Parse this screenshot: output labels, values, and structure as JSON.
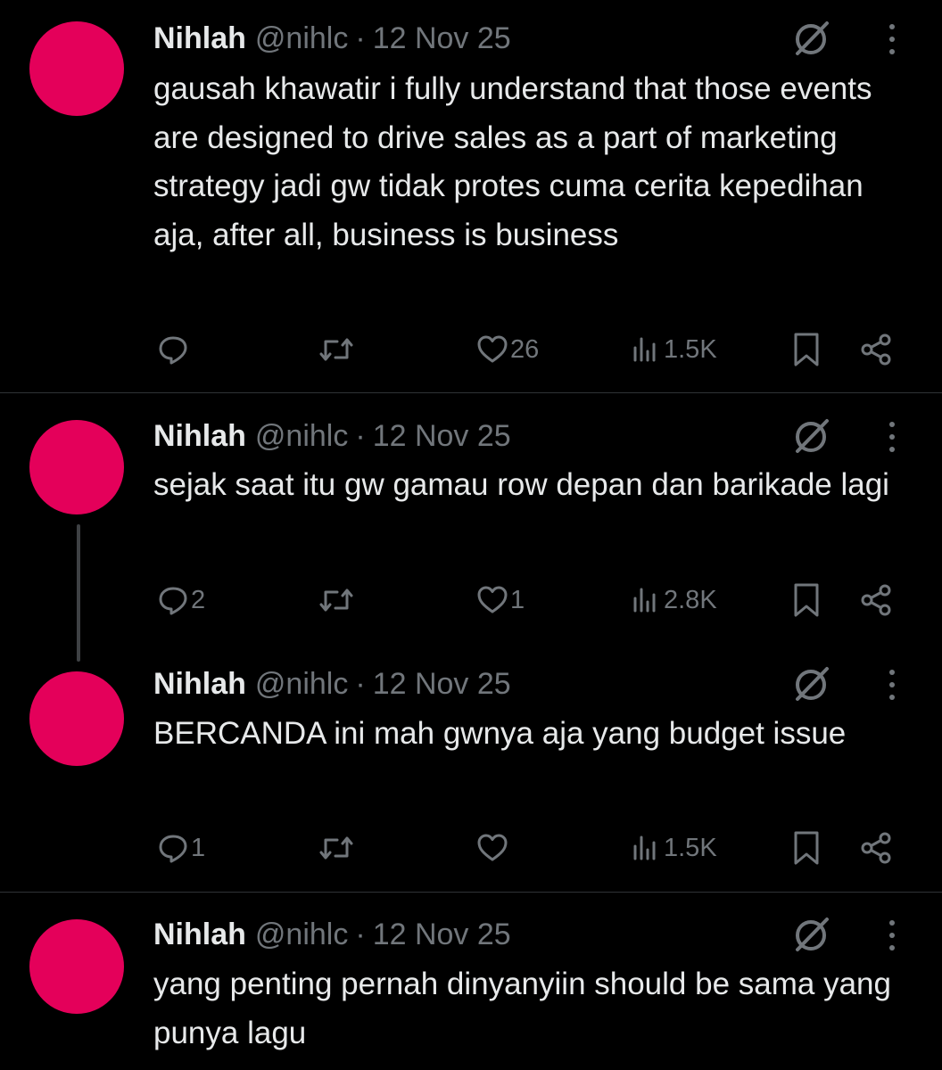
{
  "tweets": [
    {
      "author_name": "Nihlah",
      "handle": "@nihlc",
      "separator": "·",
      "date": "12 Nov 25",
      "text": "gausah khawatir i fully understand that those events are designed to drive sales as a part of marketing strategy jadi gw tidak protes cuma cerita kepedihan aja, after all, business is business",
      "stats": {
        "replies": "",
        "reposts": "",
        "likes": "26",
        "views": "1.5K"
      }
    },
    {
      "author_name": "Nihlah",
      "handle": "@nihlc",
      "separator": "·",
      "date": "12 Nov 25",
      "text": "sejak saat itu gw gamau row depan dan barikade lagi",
      "stats": {
        "replies": "2",
        "reposts": "",
        "likes": "1",
        "views": "2.8K"
      }
    },
    {
      "author_name": "Nihlah",
      "handle": "@nihlc",
      "separator": "·",
      "date": "12 Nov 25",
      "text": "BERCANDA ini mah gwnya aja yang budget issue",
      "stats": {
        "replies": "1",
        "reposts": "",
        "likes": "",
        "views": "1.5K"
      }
    },
    {
      "author_name": "Nihlah",
      "handle": "@nihlc",
      "separator": "·",
      "date": "12 Nov 25",
      "text": "yang penting pernah dinyanyiin should be sama yang punya lagu"
    }
  ],
  "colors": {
    "background": "#000000",
    "avatar": "#e4005a",
    "text_primary": "#e7e9ea",
    "text_secondary": "#71767b",
    "divider": "#2f3336"
  },
  "icons": [
    "reply-icon",
    "repost-icon",
    "like-icon",
    "views-icon",
    "bookmark-icon",
    "share-icon",
    "grok-icon",
    "more-icon"
  ]
}
